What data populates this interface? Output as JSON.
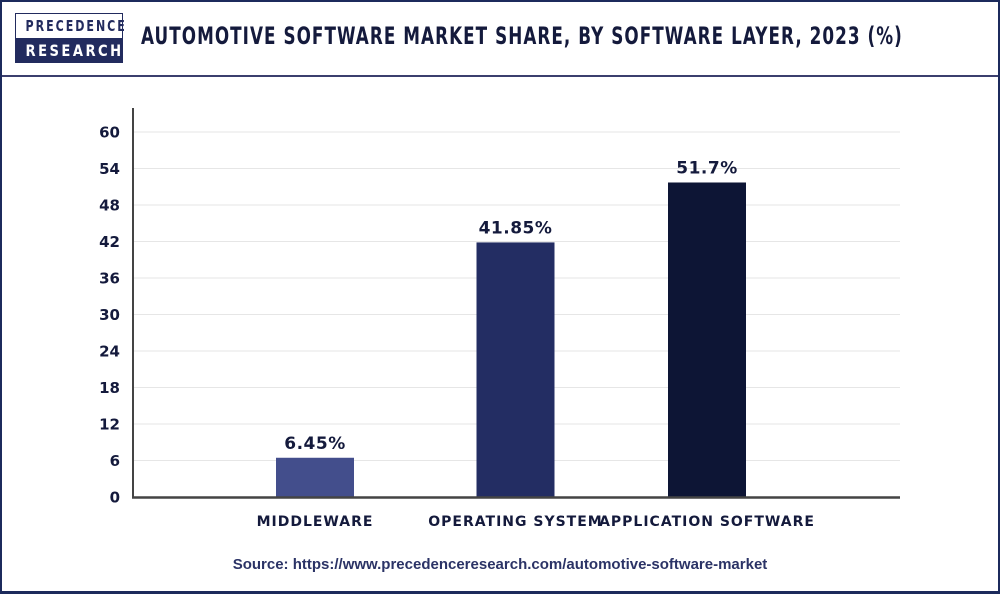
{
  "logo": {
    "line1": "PRECEDENCE",
    "line2": "RESEARCH"
  },
  "header": {
    "title": "AUTOMOTIVE SOFTWARE MARKET SHARE, BY SOFTWARE LAYER, 2023 (%)"
  },
  "footer": {
    "source": "Source: https://www.precedenceresearch.com/automotive-software-market"
  },
  "colors": {
    "frame": "#1c2a5c",
    "text": "#141a3c",
    "grid": "#e6e6e6",
    "axis": "#444444"
  },
  "chart_data": {
    "type": "bar",
    "title": "AUTOMOTIVE SOFTWARE MARKET SHARE, BY SOFTWARE LAYER, 2023 (%)",
    "xlabel": "",
    "ylabel": "",
    "categories": [
      "MIDDLEWARE",
      "OPERATING SYSTEM",
      "APPLICATION SOFTWARE"
    ],
    "values": [
      6.45,
      41.85,
      51.7
    ],
    "data_labels": [
      "6.45%",
      "41.85%",
      "51.7%"
    ],
    "bar_colors": [
      "#434e8c",
      "#232d63",
      "#0d1535"
    ],
    "ylim": [
      0,
      60
    ],
    "yticks": [
      0,
      6,
      12,
      18,
      24,
      30,
      36,
      42,
      48,
      54,
      60
    ],
    "grid": true,
    "legend": "none"
  }
}
